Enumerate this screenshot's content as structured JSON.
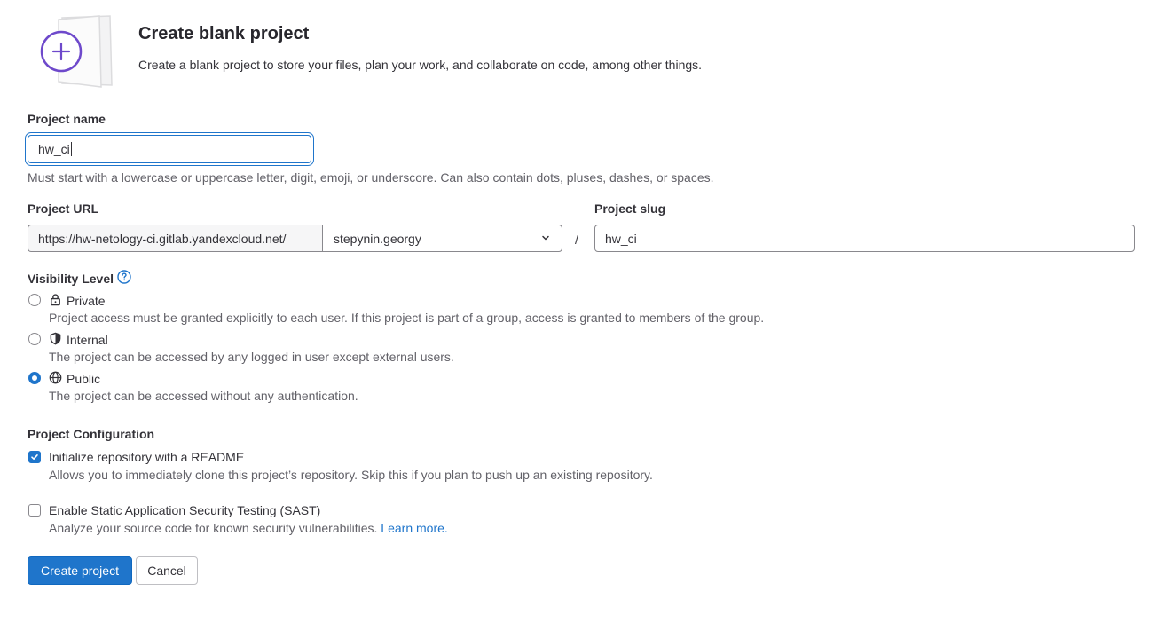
{
  "header": {
    "title": "Create blank project",
    "subtitle": "Create a blank project to store your files, plan your work, and collaborate on code, among other things."
  },
  "project_name": {
    "label": "Project name",
    "value": "hw_ci",
    "help": "Must start with a lowercase or uppercase letter, digit, emoji, or underscore. Can also contain dots, pluses, dashes, or spaces."
  },
  "project_url": {
    "label": "Project URL",
    "prefix": "https://hw-netology-ci.gitlab.yandexcloud.net/",
    "namespace": "stepynin.georgy",
    "separator": "/"
  },
  "project_slug": {
    "label": "Project slug",
    "value": "hw_ci"
  },
  "visibility": {
    "label": "Visibility Level",
    "selected": "Public",
    "options": [
      {
        "label": "Private",
        "icon": "lock-icon",
        "description": "Project access must be granted explicitly to each user. If this project is part of a group, access is granted to members of the group."
      },
      {
        "label": "Internal",
        "icon": "shield-icon",
        "description": "The project can be accessed by any logged in user except external users."
      },
      {
        "label": "Public",
        "icon": "globe-icon",
        "description": "The project can be accessed without any authentication."
      }
    ]
  },
  "configuration": {
    "label": "Project Configuration",
    "readme": {
      "label": "Initialize repository with a README",
      "checked": true,
      "description": "Allows you to immediately clone this project’s repository. Skip this if you plan to push up an existing repository."
    },
    "sast": {
      "label": "Enable Static Application Security Testing (SAST)",
      "checked": false,
      "description": "Analyze your source code for known security vulnerabilities.",
      "link": "Learn more."
    }
  },
  "actions": {
    "create": "Create project",
    "cancel": "Cancel"
  },
  "colors": {
    "primary": "#1f75cb",
    "illustration_accent": "#6e49cb"
  }
}
